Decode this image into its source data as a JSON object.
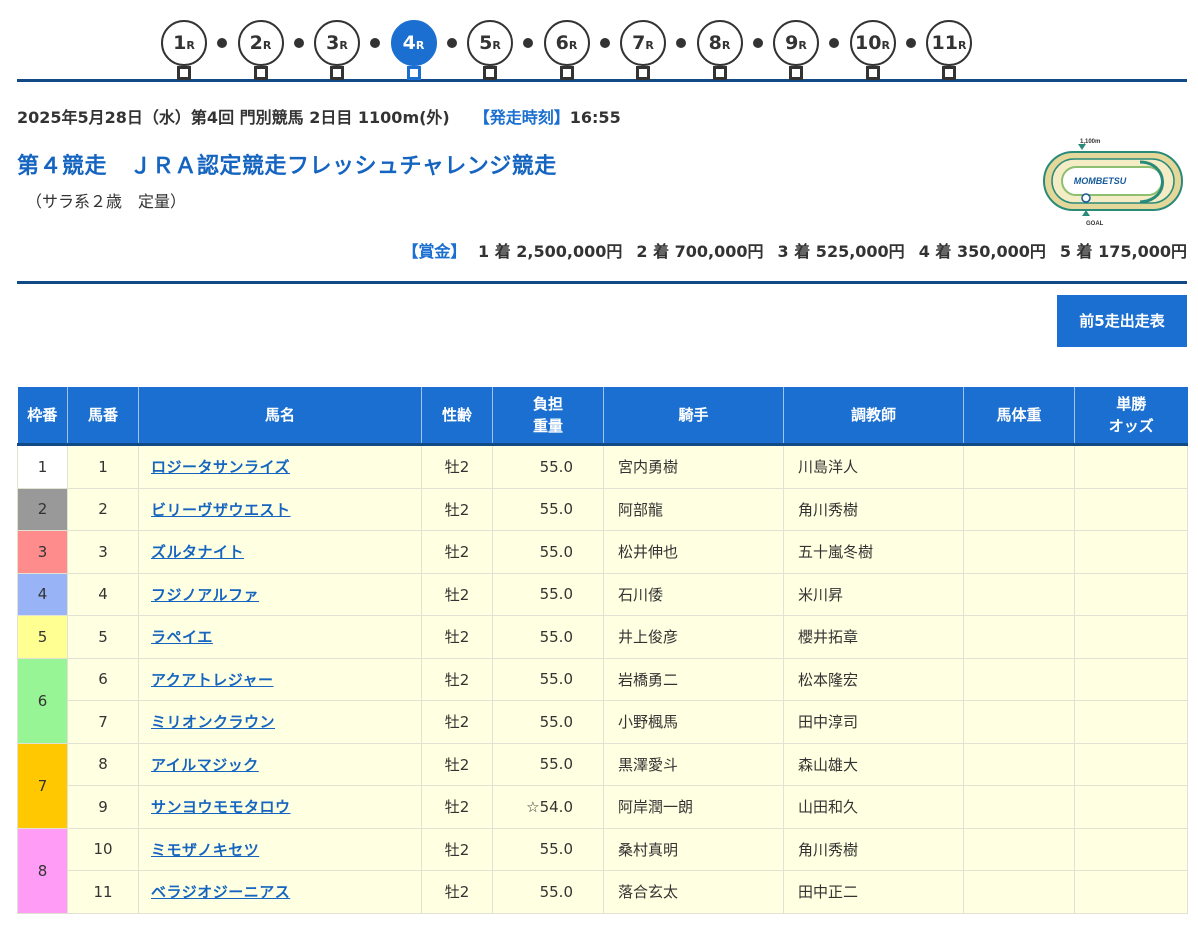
{
  "race_nav": {
    "suffix": "R",
    "races": [
      {
        "num": "1",
        "active": false
      },
      {
        "num": "2",
        "active": false
      },
      {
        "num": "3",
        "active": false
      },
      {
        "num": "4",
        "active": true
      },
      {
        "num": "5",
        "active": false
      },
      {
        "num": "6",
        "active": false
      },
      {
        "num": "7",
        "active": false
      },
      {
        "num": "8",
        "active": false
      },
      {
        "num": "9",
        "active": false
      },
      {
        "num": "10",
        "active": false
      },
      {
        "num": "11",
        "active": false
      }
    ]
  },
  "race": {
    "date_line": "2025年5月28日（水）第4回 門別競馬 2日目 1100m(外)",
    "start_label": "【発走時刻】",
    "start_time": "16:55",
    "title": "第４競走　ＪＲＡ認定競走フレッシュチャレンジ競走",
    "conditions": "（サラ系２歳　定量）"
  },
  "course_map": {
    "distance_label": "1,100m",
    "track_name": "MOMBETSU",
    "goal_label": "GOAL"
  },
  "prize": {
    "label": "【賞金】",
    "items": [
      "1 着 2,500,000円",
      "2 着 700,000円",
      "3 着 525,000円",
      "4 着 350,000円",
      "5 着 175,000円"
    ]
  },
  "prev_button_label": "前5走出走表",
  "table": {
    "headers": {
      "waku": "枠番",
      "uma": "馬番",
      "name": "馬名",
      "sexage": "性齢",
      "weight_1": "負担",
      "weight_2": "重量",
      "jockey": "騎手",
      "trainer": "調教師",
      "body_weight": "馬体重",
      "odds_1": "単勝",
      "odds_2": "オッズ"
    },
    "waku_colors": {
      "1": "#ffffff",
      "2": "#999999",
      "3": "#ff8c8c",
      "4": "#98b4f7",
      "5": "#ffff92",
      "6": "#98f596",
      "7": "#ffc800",
      "8": "#ff9cf5"
    },
    "rows": [
      {
        "waku": "1",
        "uma": "1",
        "name": "ロジータサンライズ",
        "sexage": "牡2",
        "weight": "55.0",
        "jockey": "宮内勇樹",
        "trainer": "川島洋人",
        "body_weight": "",
        "odds": ""
      },
      {
        "waku": "2",
        "uma": "2",
        "name": "ビリーヴザウエスト",
        "sexage": "牡2",
        "weight": "55.0",
        "jockey": "阿部龍",
        "trainer": "角川秀樹",
        "body_weight": "",
        "odds": ""
      },
      {
        "waku": "3",
        "uma": "3",
        "name": "ズルタナイト",
        "sexage": "牡2",
        "weight": "55.0",
        "jockey": "松井伸也",
        "trainer": "五十嵐冬樹",
        "body_weight": "",
        "odds": ""
      },
      {
        "waku": "4",
        "uma": "4",
        "name": "フジノアルファ",
        "sexage": "牡2",
        "weight": "55.0",
        "jockey": "石川倭",
        "trainer": "米川昇",
        "body_weight": "",
        "odds": ""
      },
      {
        "waku": "5",
        "uma": "5",
        "name": "ラペイエ",
        "sexage": "牡2",
        "weight": "55.0",
        "jockey": "井上俊彦",
        "trainer": "櫻井拓章",
        "body_weight": "",
        "odds": ""
      },
      {
        "waku": "6",
        "uma": "6",
        "name": "アクアトレジャー",
        "sexage": "牡2",
        "weight": "55.0",
        "jockey": "岩橋勇二",
        "trainer": "松本隆宏",
        "body_weight": "",
        "odds": ""
      },
      {
        "waku": "6",
        "uma": "7",
        "name": "ミリオンクラウン",
        "sexage": "牡2",
        "weight": "55.0",
        "jockey": "小野楓馬",
        "trainer": "田中淳司",
        "body_weight": "",
        "odds": ""
      },
      {
        "waku": "7",
        "uma": "8",
        "name": "アイルマジック",
        "sexage": "牡2",
        "weight": "55.0",
        "jockey": "黒澤愛斗",
        "trainer": "森山雄大",
        "body_weight": "",
        "odds": ""
      },
      {
        "waku": "7",
        "uma": "9",
        "name": "サンヨウモモタロウ",
        "sexage": "牡2",
        "weight": "☆54.0",
        "jockey": "阿岸潤一朗",
        "trainer": "山田和久",
        "body_weight": "",
        "odds": ""
      },
      {
        "waku": "8",
        "uma": "10",
        "name": "ミモザノキセツ",
        "sexage": "牡2",
        "weight": "55.0",
        "jockey": "桑村真明",
        "trainer": "角川秀樹",
        "body_weight": "",
        "odds": ""
      },
      {
        "waku": "8",
        "uma": "11",
        "name": "ベラジオジーニアス",
        "sexage": "牡2",
        "weight": "55.0",
        "jockey": "落合玄太",
        "trainer": "田中正二",
        "body_weight": "",
        "odds": ""
      }
    ]
  }
}
